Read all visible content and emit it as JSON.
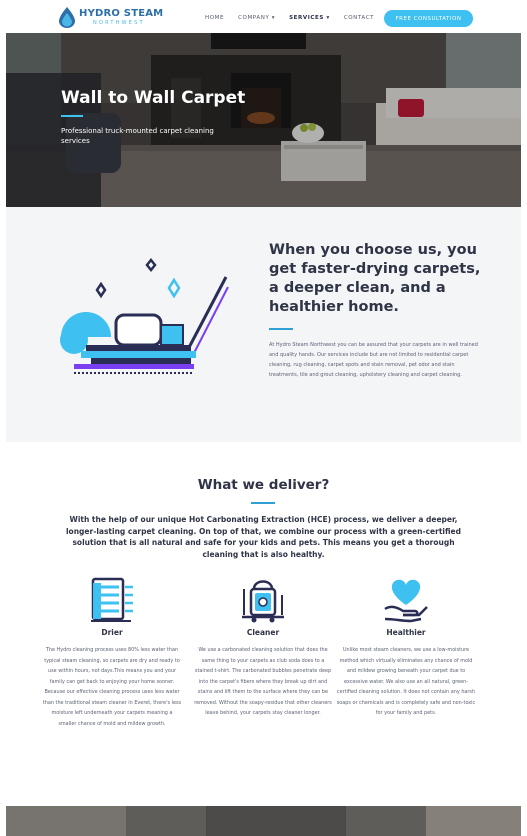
{
  "header": {
    "logo_title": "HYDRO STEAM",
    "logo_subtitle": "NORTHWEST",
    "nav": [
      {
        "label": "HOME"
      },
      {
        "label": "COMPANY ▾"
      },
      {
        "label": "SERVICES ▾"
      },
      {
        "label": "CONTACT"
      }
    ],
    "cta_label": "FREE CONSULTATION",
    "accent_color": "#3ec0f0"
  },
  "hero": {
    "title": "Wall to Wall Carpet",
    "subtitle": "Professional truck-mounted carpet cleaning services"
  },
  "choose": {
    "title": "When you choose us, you get faster-drying carpets, a deeper clean, and a healthier home.",
    "body": "At Hydro Steam Northwest you can be assured that your carpets are in well trained and quality hands. Our services include but are not limited to residential carpet cleaning, rug cleaning, carpet spots and stain removal, pet odor and stain treatments, tile and grout cleaning, upholstery cleaning and carpet cleaning."
  },
  "deliver": {
    "title": "What we deliver?",
    "intro": "With the help of our unique Hot Carbonating Extraction (HCE) process, we deliver a deeper, longer-lasting carpet cleaning. On top of that, we combine our process with a green-certified solution that is all natural and safe for your kids and pets. This means you get a thorough cleaning that is also healthy.",
    "features": [
      {
        "icon": "carpet-roll-icon",
        "title": "Drier",
        "body": "The Hydro cleaning process uses 80% less water than typical steam cleaning, so carpets are dry and ready to use within hours, not days.This means you and your family can get back to enjoying your home sooner. Because our effective cleaning process uses less water than the traditional steam cleaner in Everet, there's less moisture left underneath your carpets meaning a smaller chance of mold and mildew growth."
      },
      {
        "icon": "cleaning-machine-icon",
        "title": "Cleaner",
        "body": "We use a carbonated cleaning solution that does the same thing to your carpets as club soda does to a stained t-shirt. The carbonated bubbles penetrate deep into the carpet's fibers where they break up dirt and stains and lift them to the surface where they can be removed. Without the soapy-residue that other cleaners leave behind, your carpets stay cleaner longer."
      },
      {
        "icon": "heart-hand-icon",
        "title": "Healthier",
        "body": "Unlike most steam cleaners, we use a low-moisture method which virtually eliminates any chance of mold and mildew growing beneath your carpet due to excessive water. We also use an all natural, green-certified cleaning solution. It does not contain any harsh soaps or chemicals and is completely safe and non-toxic for your family and pets."
      }
    ]
  }
}
